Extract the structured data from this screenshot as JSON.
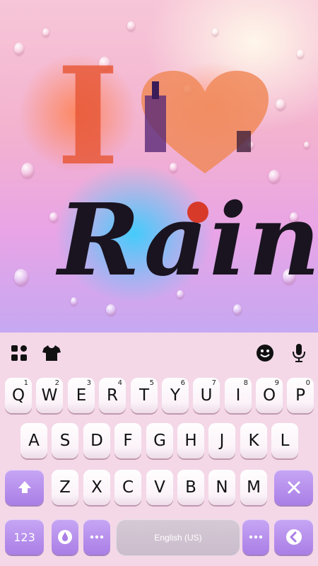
{
  "wallpaper": {
    "art_letters": {
      "i": "I",
      "rain": "Rain"
    }
  },
  "toolbar": {
    "left_icons": [
      "apps-grid-icon",
      "theme-shirt-icon"
    ],
    "right_icons": [
      "emoji-icon",
      "microphone-icon"
    ]
  },
  "keyboard": {
    "row1": [
      {
        "label": "Q",
        "hint": "1"
      },
      {
        "label": "W",
        "hint": "2"
      },
      {
        "label": "E",
        "hint": "3"
      },
      {
        "label": "R",
        "hint": "4"
      },
      {
        "label": "T",
        "hint": "5"
      },
      {
        "label": "Y",
        "hint": "6"
      },
      {
        "label": "U",
        "hint": "7"
      },
      {
        "label": "I",
        "hint": "8"
      },
      {
        "label": "O",
        "hint": "9"
      },
      {
        "label": "P",
        "hint": "0"
      }
    ],
    "row2": [
      "A",
      "S",
      "D",
      "F",
      "G",
      "H",
      "J",
      "K",
      "L"
    ],
    "row3": [
      "Z",
      "X",
      "C",
      "V",
      "B",
      "N",
      "M"
    ],
    "numbers_label": "123",
    "space_label": "English (US)"
  },
  "colors": {
    "accent_purple": "#b08aec",
    "key_text": "#111111"
  }
}
